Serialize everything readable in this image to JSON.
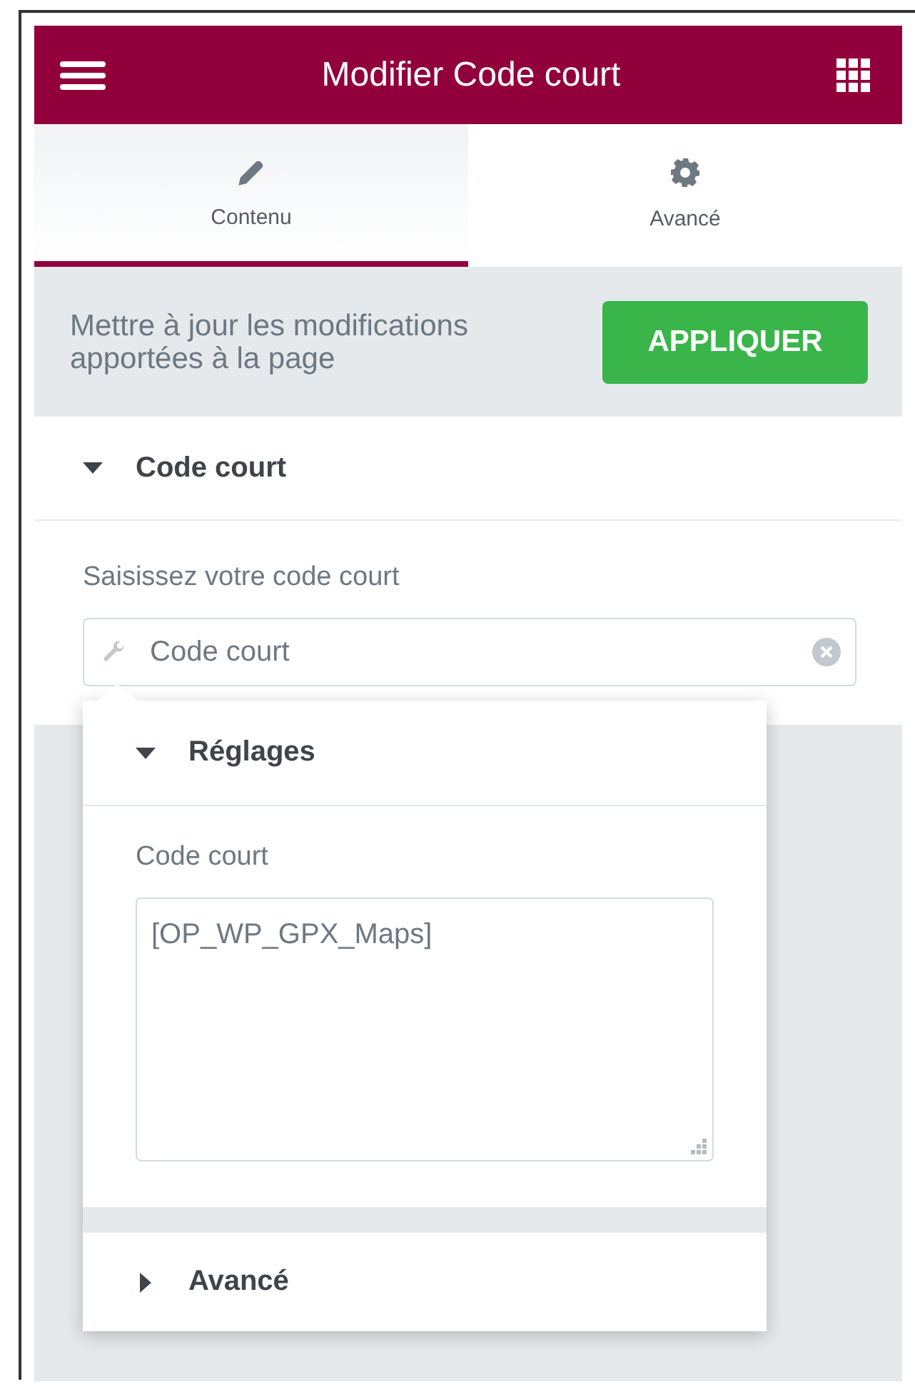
{
  "header": {
    "title": "Modifier Code court"
  },
  "tabs": [
    {
      "label": "Contenu",
      "selected": true
    },
    {
      "label": "Avancé",
      "selected": false
    }
  ],
  "update_bar": {
    "message": "Mettre à jour les modifications apportées à la page",
    "button": "APPLIQUER"
  },
  "section": {
    "title": "Code court",
    "expanded": true,
    "field_label": "Saisissez votre code court",
    "search": {
      "value": "Code court"
    }
  },
  "popup": {
    "sections": [
      {
        "title": "Réglages",
        "expanded": true,
        "field_label": "Code court",
        "value": "[OP_WP_GPX_Maps]"
      },
      {
        "title": "Avancé",
        "expanded": false
      }
    ]
  }
}
